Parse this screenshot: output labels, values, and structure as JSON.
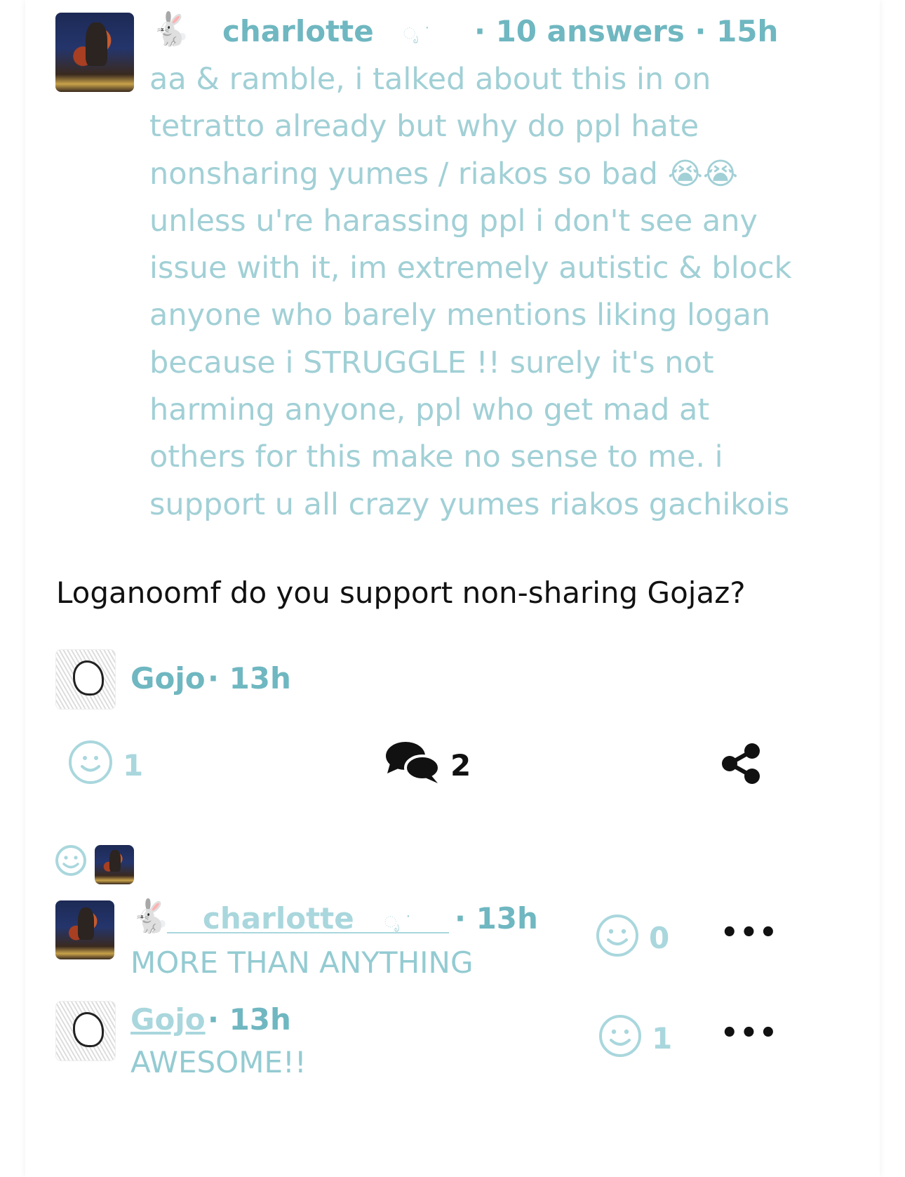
{
  "post": {
    "author": "charlotte",
    "author_emoji": "🐇",
    "author_deco": "ೃ ˙",
    "meta": "· 10 answers · 15h",
    "body": "aa & ramble, i talked about this in on tetratto already but why do ppl hate nonsharing yumes / riakos so bad 😭😭 unless u're harassing ppl i don't see any issue with it, im extremely autistic & block anyone who barely mentions liking logan because i STRUGGLE !! surely it's not harming anyone, ppl who get mad at others for this make no sense to me. i support u all crazy yumes riakos gachikois"
  },
  "answer": {
    "question": "Loganoomf do you support non-sharing Gojaz?",
    "author": "Gojo",
    "meta": "· 13h",
    "reactions_count": "1",
    "comments_count": "2"
  },
  "icons": {
    "smile": "smile-icon",
    "comments": "comments-icon",
    "share": "share-icon",
    "more": "more-icon"
  },
  "comments": [
    {
      "author": "charlotte",
      "author_emoji": "🐇",
      "author_deco": "ೃ ˙",
      "meta": "· 13h",
      "text": "MORE THAN ANYTHING",
      "reactions": "0",
      "more": "•••"
    },
    {
      "author": "Gojo",
      "meta": "· 13h",
      "text": "AWESOME!!",
      "reactions": "1",
      "more": "•••"
    }
  ]
}
